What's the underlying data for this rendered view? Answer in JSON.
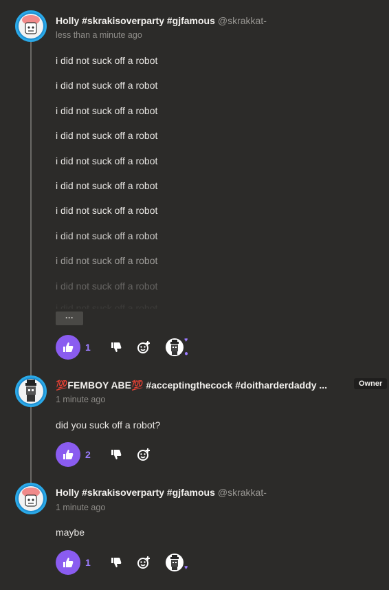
{
  "comments": [
    {
      "author": "Holly #skrakisoverparty #gjfamous",
      "handle": "@skrakkat-",
      "time": "less than a minute ago",
      "lines": [
        "i did not suck off a robot",
        "i did not suck off a robot",
        "i did not suck off a robot",
        "i did not suck off a robot",
        "i did not suck off a robot",
        "i did not suck off a robot",
        "i did not suck off a robot",
        "i did not suck off a robot",
        "i did not suck off a robot",
        "i did not suck off a robot",
        "i did not suck off a robot"
      ],
      "more_label": "···",
      "likes": "1"
    },
    {
      "author": "💯FEMBOY ABE💯 #acceptingthecock #doitharderdaddy ...",
      "badge": "Owner",
      "time": "1 minute ago",
      "text": "did you suck off a robot?",
      "likes": "2"
    },
    {
      "author": "Holly #skrakisoverparty #gjfamous",
      "handle": "@skrakkat-",
      "time": "1 minute ago",
      "text": "maybe",
      "likes": "1"
    }
  ],
  "icons": {
    "like": "thumbs-up-icon",
    "dislike": "thumbs-down-icon",
    "react": "add-reaction-icon",
    "heart": "heart-icon"
  },
  "colors": {
    "background": "#2c2b29",
    "accent": "#8a5cf0",
    "like_count": "#9b7cff"
  }
}
